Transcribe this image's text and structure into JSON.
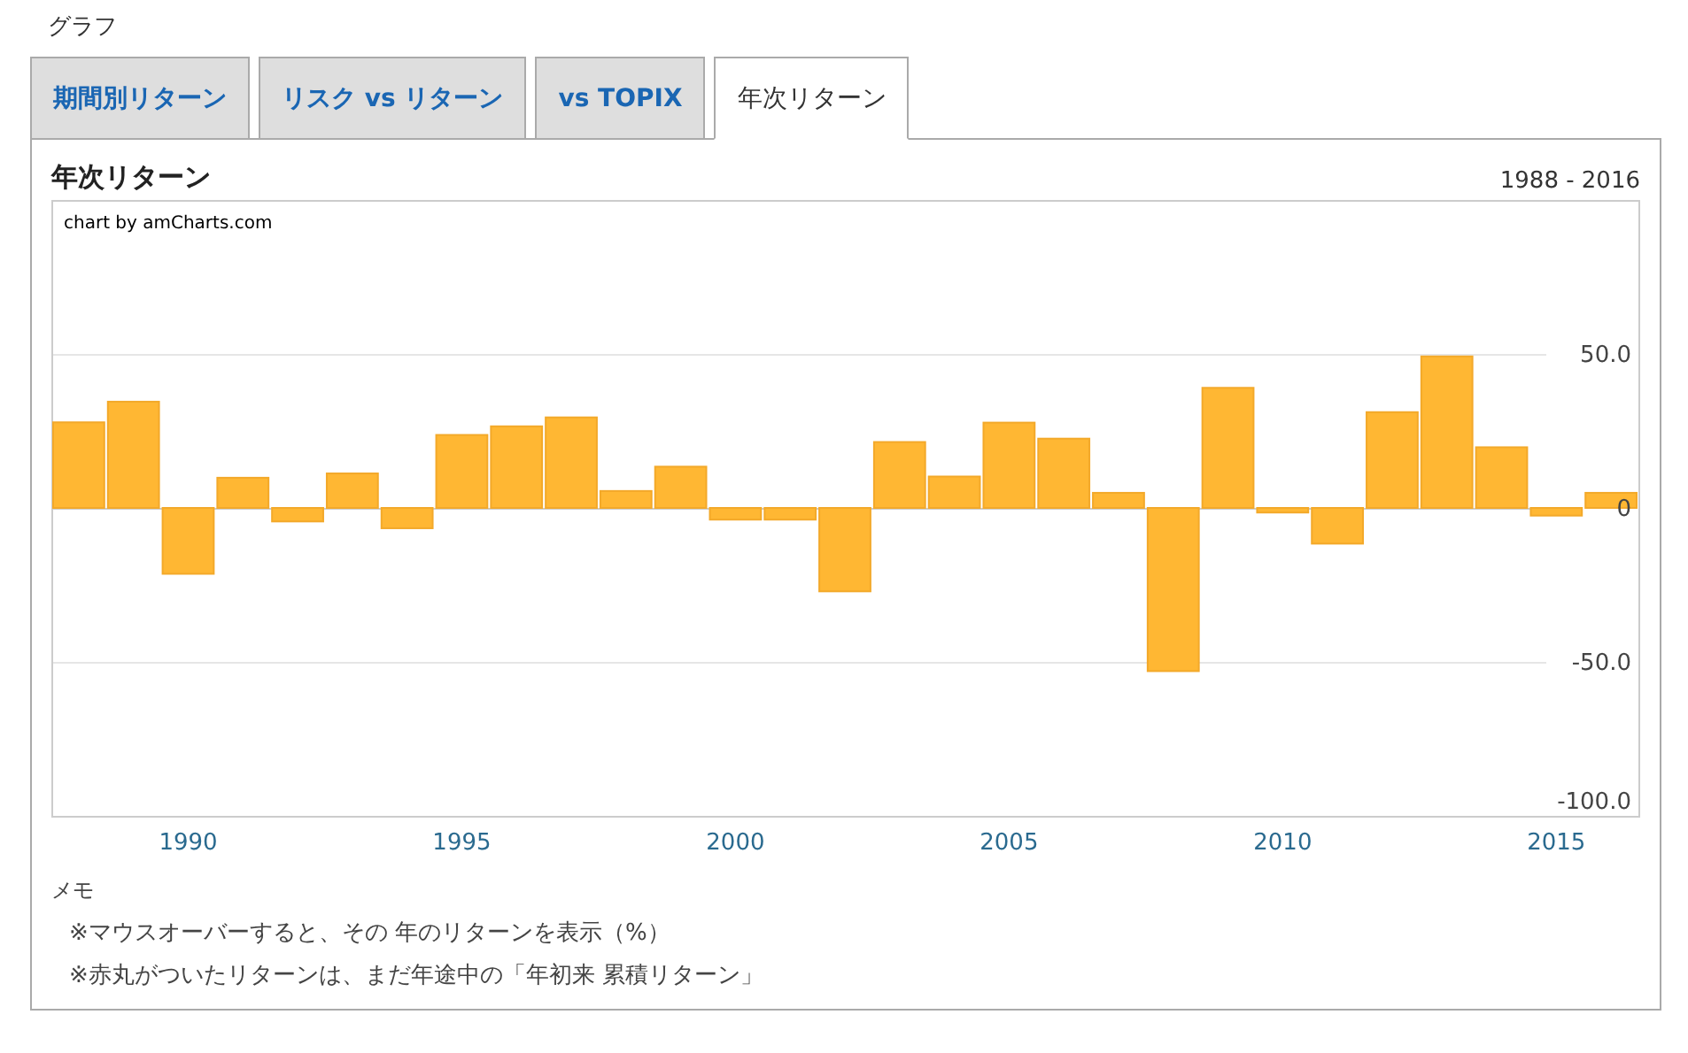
{
  "section_title": "グラフ",
  "tabs": [
    {
      "label": "期間別リターン",
      "selected": false
    },
    {
      "label": "リスク vs リターン",
      "selected": false
    },
    {
      "label": "vs TOPIX",
      "selected": false
    },
    {
      "label": "年次リターン",
      "selected": true
    }
  ],
  "panel": {
    "title": "年次リターン",
    "range": "1988 - 2016",
    "credit": "chart by amCharts.com",
    "chart_data": {
      "type": "bar",
      "x": [
        1988,
        1989,
        1990,
        1991,
        1992,
        1993,
        1994,
        1995,
        1996,
        1997,
        1998,
        1999,
        2000,
        2001,
        2002,
        2003,
        2004,
        2005,
        2006,
        2007,
        2008,
        2009,
        2010,
        2011,
        2012,
        2013,
        2014,
        2015,
        2016
      ],
      "series": [
        {
          "color": "#ffb733",
          "values": [
            27.8,
            34.5,
            -21.4,
            9.8,
            -4.4,
            11.2,
            -6.6,
            23.7,
            26.5,
            29.4,
            5.5,
            13.4,
            -3.8,
            -3.8,
            -27.1,
            21.4,
            10.2,
            27.7,
            22.5,
            4.9,
            -53.0,
            39.0,
            -1.5,
            -11.6,
            31.1,
            49.2,
            19.7,
            -2.5,
            4.9
          ]
        }
      ],
      "xlim": [
        1987.5,
        2016.5
      ],
      "ylim": [
        -100,
        100
      ],
      "yticks": [
        {
          "value": 50,
          "label": "50.0"
        },
        {
          "value": 0,
          "label": "0"
        },
        {
          "value": -50,
          "label": "-50.0"
        },
        {
          "value": -100,
          "label": "-100.0"
        }
      ],
      "xticks": [
        1990,
        1995,
        2000,
        2005,
        2010,
        2015
      ]
    }
  },
  "memo": {
    "title": "メモ",
    "lines": [
      "※マウスオーバーすると、その 年のリターンを表示（%）",
      "※赤丸がついたリターンは、まだ年途中の「年初来 累積リターン」"
    ]
  }
}
